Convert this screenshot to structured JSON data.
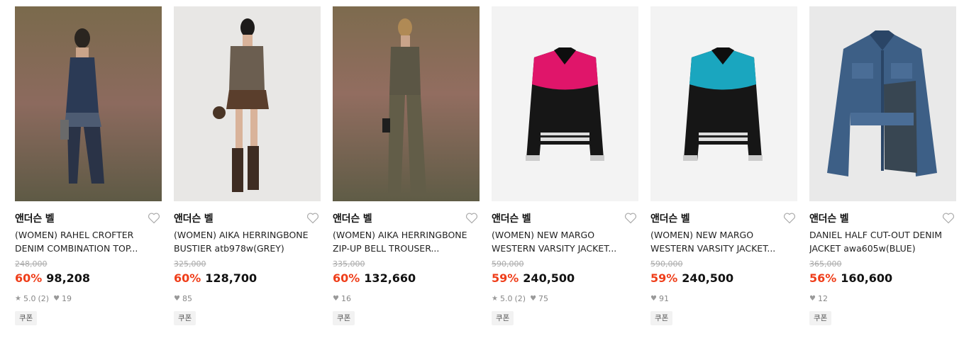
{
  "products": [
    {
      "brand": "앤더슨 벨",
      "name": "(WOMEN) RAHEL CROFTER DENIM COMBINATION TOP...",
      "original_price": "248,000",
      "discount": "60%",
      "price": "98,208",
      "rating": "5.0",
      "review_count": "(2)",
      "likes": "19",
      "coupon": "쿠폰"
    },
    {
      "brand": "앤더슨 벨",
      "name": "(WOMEN) AIKA HERRINGBONE BUSTIER atb978w(GREY)",
      "original_price": "325,000",
      "discount": "60%",
      "price": "128,700",
      "likes": "85",
      "coupon": "쿠폰"
    },
    {
      "brand": "앤더슨 벨",
      "name": "(WOMEN) AIKA HERRINGBONE ZIP-UP BELL TROUSER...",
      "original_price": "335,000",
      "discount": "60%",
      "price": "132,660",
      "likes": "16",
      "coupon": "쿠폰"
    },
    {
      "brand": "앤더슨 벨",
      "name": "(WOMEN) NEW MARGO WESTERN VARSITY JACKET...",
      "original_price": "590,000",
      "discount": "59%",
      "price": "240,500",
      "rating": "5.0",
      "review_count": "(2)",
      "likes": "75",
      "coupon": "쿠폰"
    },
    {
      "brand": "앤더슨 벨",
      "name": "(WOMEN) NEW MARGO WESTERN VARSITY JACKET...",
      "original_price": "590,000",
      "discount": "59%",
      "price": "240,500",
      "likes": "91",
      "coupon": "쿠폰"
    },
    {
      "brand": "앤더슨 벨",
      "name": "DANIEL HALF CUT-OUT DENIM JACKET awa605w(BLUE)",
      "original_price": "365,000",
      "discount": "56%",
      "price": "160,600",
      "likes": "12",
      "coupon": "쿠폰"
    }
  ],
  "icons": {
    "wishlist": "heart-outline-icon",
    "rating": "star-icon",
    "likes": "heart-filled-icon"
  },
  "colors": {
    "discount": "#ef3e1a",
    "text": "#111111",
    "muted": "#888888",
    "coupon_bg": "#f2f2f2"
  }
}
